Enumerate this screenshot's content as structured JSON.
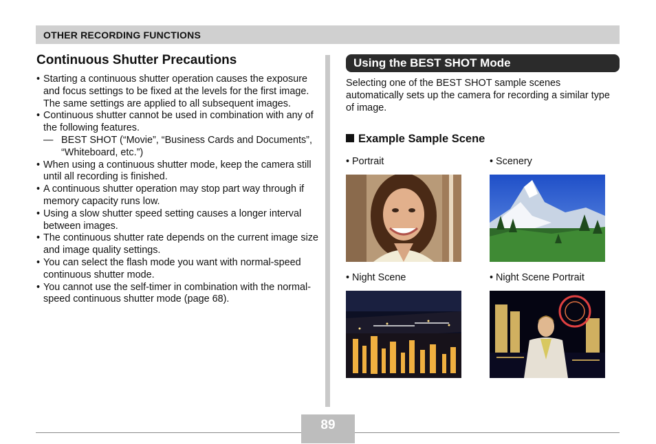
{
  "header": {
    "section_title": "OTHER RECORDING FUNCTIONS"
  },
  "left": {
    "title": "Continuous Shutter Precautions",
    "bullets": [
      "Starting a continuous shutter operation causes the exposure and focus settings to be fixed at the levels for the first image. The same settings are applied to all subsequent images.",
      "Continuous shutter cannot be used in combination with any of the following features.",
      "BEST SHOT (“Movie”, “Business Cards and Documents”, “Whiteboard, etc.”)",
      "When using a continuous shutter mode, keep the camera still until all recording is finished.",
      "A continuous shutter operation may stop part way through if memory capacity runs low.",
      "Using a slow shutter speed setting causes a longer interval between images.",
      "The continuous shutter rate depends on the current image size and image quality settings.",
      "You can select the flash mode you want with normal-speed continuous shutter mode.",
      "You cannot use the self-timer in combination with the normal-speed continuous shutter mode (page 68)."
    ],
    "bullet_symbol": "•",
    "dash_symbol": "—"
  },
  "right": {
    "section_title": "Using the BEST SHOT Mode",
    "intro": "Selecting one of the BEST SHOT sample scenes automatically sets up the camera for recording a similar type of image.",
    "subhead": "Example Sample Scene",
    "scenes": [
      {
        "label": "• Portrait"
      },
      {
        "label": "• Scenery"
      },
      {
        "label": "• Night Scene"
      },
      {
        "label": "• Night Scene Portrait"
      }
    ]
  },
  "footer": {
    "page_number": "89"
  },
  "colors": {
    "header_bar": "#d0d0d0",
    "section_bar": "#2b2b2b",
    "divider": "#c9c9c9",
    "page_box": "#bdbdbd"
  }
}
